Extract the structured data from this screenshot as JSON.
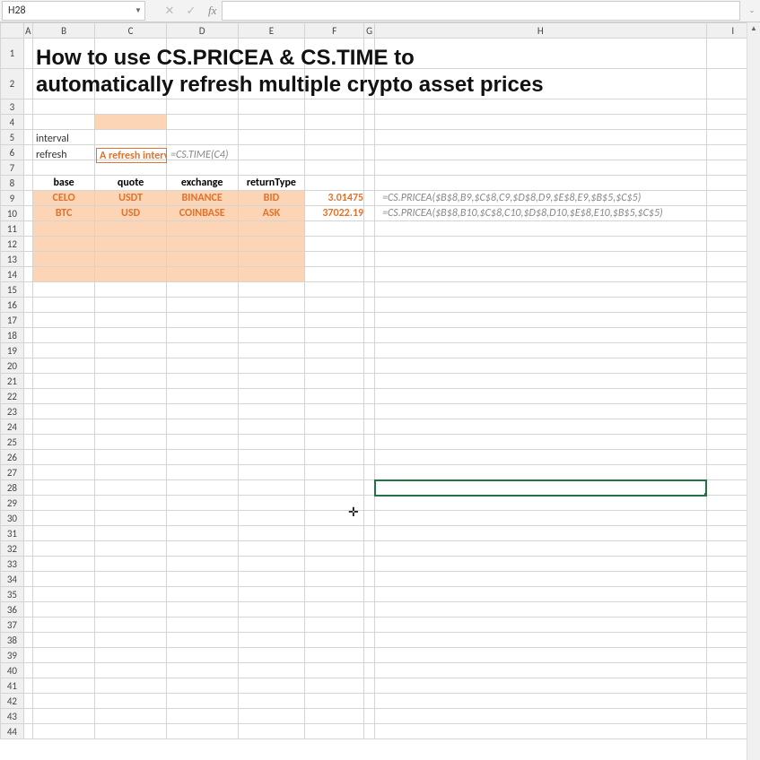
{
  "nameBox": "H28",
  "formulaBar": "",
  "title_line1": "How to use CS.PRICEA & CS.TIME to",
  "title_line2": "automatically refresh multiple crypto asset prices",
  "labels": {
    "interval": "interval",
    "refresh": "refresh"
  },
  "c5_text": "A refresh interv",
  "d5_text": "=CS.TIME(C4)",
  "colhdrs": [
    "A",
    "B",
    "C",
    "D",
    "E",
    "F",
    "G",
    "H",
    "I"
  ],
  "table": {
    "headers": {
      "base": "base",
      "quote": "quote",
      "exchange": "exchange",
      "returnType": "returnType"
    },
    "rows": [
      {
        "base": "CELO",
        "quote": "USDT",
        "exchange": "BINANCE",
        "returnType": "BID",
        "price": "3.01475",
        "formula": "=CS.PRICEA($B$8,B9,$C$8,C9,$D$8,D9,$E$8,E9,$B$5,$C$5)"
      },
      {
        "base": "BTC",
        "quote": "USD",
        "exchange": "COINBASE",
        "returnType": "ASK",
        "price": "37022.19",
        "formula": "=CS.PRICEA($B$8,B10,$C$8,C10,$D$8,D10,$E$8,E10,$B$5,$C$5)"
      }
    ]
  },
  "selectedCell": "H28"
}
